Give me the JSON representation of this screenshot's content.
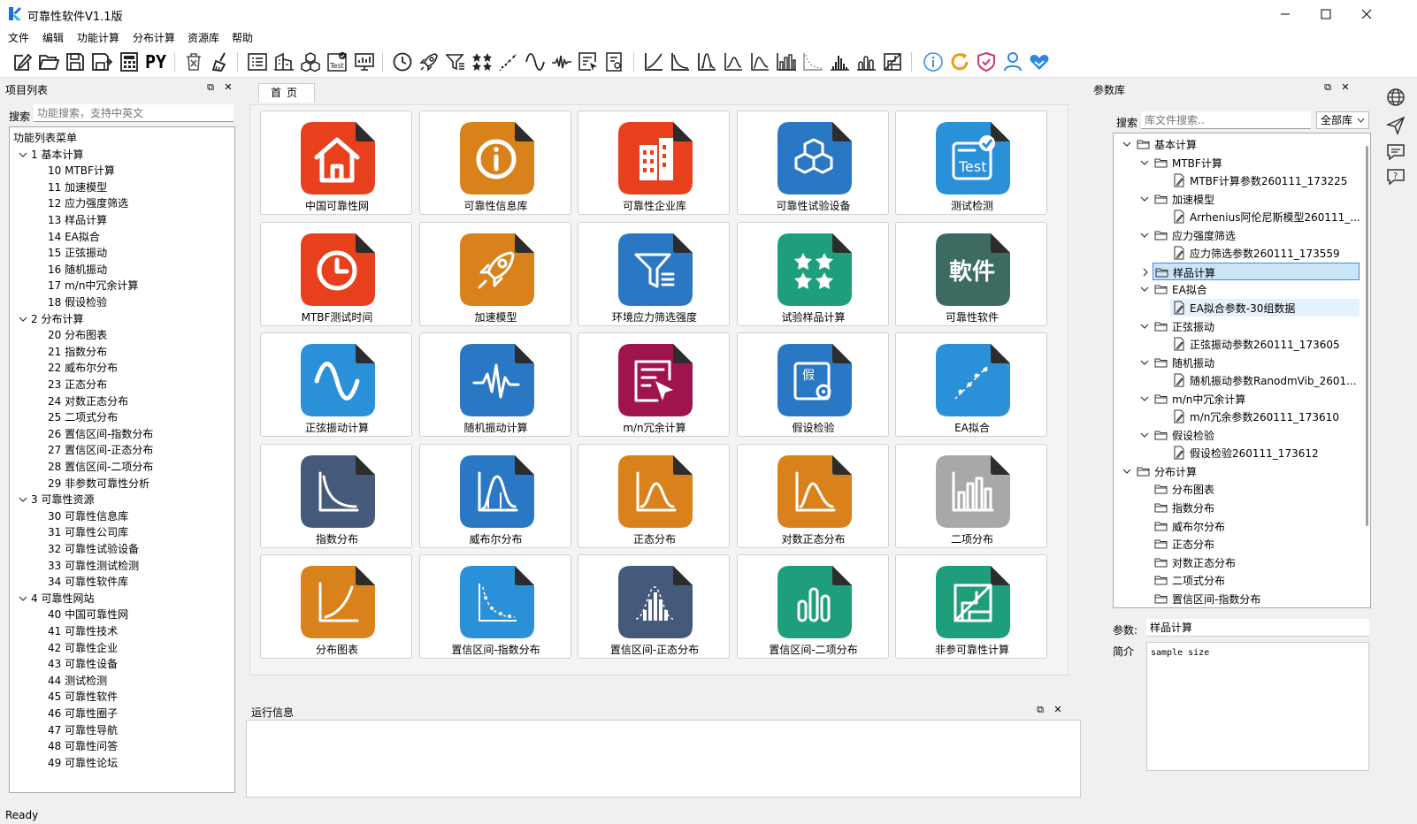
{
  "window": {
    "title": "可靠性软件V1.1版",
    "minimize_icon": "minimize-icon",
    "maximize_icon": "maximize-icon",
    "close_icon": "close-icon"
  },
  "menu": [
    "文件",
    "编辑",
    "功能计算",
    "分布计算",
    "资源库",
    "帮助"
  ],
  "toolbar": {
    "py_label": "PY",
    "test_label": "Test"
  },
  "left_panel": {
    "title": "项目列表",
    "search_label": "搜索",
    "search_placeholder": "功能搜索，支持中英文",
    "root": "功能列表菜单",
    "groups": [
      {
        "label": "1 基本计算",
        "items": [
          "10 MTBF计算",
          "11 加速模型",
          "12 应力强度筛选",
          "13 样品计算",
          "14 EA拟合",
          "15 正弦振动",
          "16 随机振动",
          "17 m/n中冗余计算",
          "18 假设检验"
        ]
      },
      {
        "label": "2 分布计算",
        "items": [
          "20 分布图表",
          "21 指数分布",
          "22 威布尔分布",
          "23 正态分布",
          "24 对数正态分布",
          "25 二项式分布",
          "26 置信区间-指数分布",
          "27 置信区间-正态分布",
          "28 置信区间-二项分布",
          "29 非参数可靠性分析"
        ]
      },
      {
        "label": "3 可靠性资源",
        "items": [
          "30 可靠性信息库",
          "31 可靠性公司库",
          "32 可靠性试验设备",
          "33 可靠性测试检测",
          "34 可靠性软件库"
        ]
      },
      {
        "label": "4 可靠性网站",
        "items": [
          "40 中国可靠性网",
          "41 可靠性技术",
          "42 可靠性企业",
          "43 可靠性设备",
          "44 测试检测",
          "45 可靠性软件",
          "46 可靠性圈子",
          "47 可靠性导航",
          "48 可靠性问答",
          "49 可靠性论坛"
        ]
      }
    ]
  },
  "center": {
    "tab": "首页",
    "cards": [
      {
        "label": "中国可靠性网",
        "icon": "home-icon",
        "color": "#e8401c"
      },
      {
        "label": "可靠性信息库",
        "icon": "info-icon",
        "color": "#d9821c"
      },
      {
        "label": "可靠性企业库",
        "icon": "building-icon",
        "color": "#e8401c"
      },
      {
        "label": "可靠性试验设备",
        "icon": "cubes-icon",
        "color": "#2a78c4"
      },
      {
        "label": "测试检测",
        "icon": "test-check-icon",
        "color": "#2a90d8"
      },
      {
        "label": "MTBF测试时间",
        "icon": "clock-icon",
        "color": "#e8401c"
      },
      {
        "label": "加速模型",
        "icon": "rocket-icon",
        "color": "#d9821c"
      },
      {
        "label": "环境应力筛选强度",
        "icon": "filter-icon",
        "color": "#2a78c4"
      },
      {
        "label": "试验样品计算",
        "icon": "stars-icon",
        "color": "#1e9e7a"
      },
      {
        "label": "可靠性软件",
        "icon": "software-text-icon",
        "color": "#3d6b62",
        "text": "軟件"
      },
      {
        "label": "正弦振动计算",
        "icon": "sine-wave-icon",
        "color": "#2a90d8"
      },
      {
        "label": "随机振动计算",
        "icon": "random-wave-icon",
        "color": "#2a78c4"
      },
      {
        "label": "m/n冗余计算",
        "icon": "form-pointer-icon",
        "color": "#a0144e"
      },
      {
        "label": "假设检验",
        "icon": "hypothesis-icon",
        "color": "#2a78c4",
        "text": "假"
      },
      {
        "label": "EA拟合",
        "icon": "scatter-fit-icon",
        "color": "#2a90d8"
      },
      {
        "label": "指数分布",
        "icon": "exp-curve-icon",
        "color": "#455a7a"
      },
      {
        "label": "威布尔分布",
        "icon": "weibull-curve-icon",
        "color": "#2a78c4"
      },
      {
        "label": "正态分布",
        "icon": "normal-curve-icon",
        "color": "#d9821c"
      },
      {
        "label": "对数正态分布",
        "icon": "lognormal-curve-icon",
        "color": "#d9821c"
      },
      {
        "label": "二项分布",
        "icon": "bar-chart-icon",
        "color": "#a8a8a8"
      },
      {
        "label": "分布图表",
        "icon": "curve-chart-icon",
        "color": "#d9821c"
      },
      {
        "label": "置信区间-指数分布",
        "icon": "confidence-exp-icon",
        "color": "#2a90d8"
      },
      {
        "label": "置信区间-正态分布",
        "icon": "confidence-normal-icon",
        "color": "#455a7a"
      },
      {
        "label": "置信区间-二项分布",
        "icon": "confidence-binomial-icon",
        "color": "#1e9e7a"
      },
      {
        "label": "非参可靠性计算",
        "icon": "nonparam-icon",
        "color": "#1e9e7a"
      }
    ]
  },
  "run_panel": {
    "title": "运行信息"
  },
  "right_panel": {
    "title": "参数库",
    "search_label": "搜索",
    "search_placeholder": "库文件搜索..",
    "select_value": "全部库",
    "tree": [
      {
        "level": 0,
        "label": "基本计算",
        "type": "folder",
        "expanded": true
      },
      {
        "level": 1,
        "label": "MTBF计算",
        "type": "folder",
        "expanded": true
      },
      {
        "level": 2,
        "label": "MTBF计算参数260111_173225",
        "type": "doc"
      },
      {
        "level": 1,
        "label": "加速模型",
        "type": "folder",
        "expanded": true
      },
      {
        "level": 2,
        "label": "Arrhenius阿伦尼斯模型260111_...",
        "type": "doc"
      },
      {
        "level": 1,
        "label": "应力强度筛选",
        "type": "folder",
        "expanded": true
      },
      {
        "level": 2,
        "label": "应力筛选参数260111_173559",
        "type": "doc"
      },
      {
        "level": 1,
        "label": "样品计算",
        "type": "folder",
        "expanded": false,
        "selected": true
      },
      {
        "level": 1,
        "label": "EA拟合",
        "type": "folder",
        "expanded": true
      },
      {
        "level": 2,
        "label": "EA拟合参数-30组数据",
        "type": "doc",
        "hover": true
      },
      {
        "level": 1,
        "label": "正弦振动",
        "type": "folder",
        "expanded": true
      },
      {
        "level": 2,
        "label": "正弦振动参数260111_173605",
        "type": "doc"
      },
      {
        "level": 1,
        "label": "随机振动",
        "type": "folder",
        "expanded": true
      },
      {
        "level": 2,
        "label": "随机振动参数RanodmVib_2601...",
        "type": "doc"
      },
      {
        "level": 1,
        "label": "m/n中冗余计算",
        "type": "folder",
        "expanded": true
      },
      {
        "level": 2,
        "label": "m/n冗余参数260111_173610",
        "type": "doc"
      },
      {
        "level": 1,
        "label": "假设检验",
        "type": "folder",
        "expanded": true
      },
      {
        "level": 2,
        "label": "假设检验260111_173612",
        "type": "doc"
      },
      {
        "level": 0,
        "label": "分布计算",
        "type": "folder",
        "expanded": true
      },
      {
        "level": 1,
        "label": "分布图表",
        "type": "folder-leaf"
      },
      {
        "level": 1,
        "label": "指数分布",
        "type": "folder-leaf"
      },
      {
        "level": 1,
        "label": "威布尔分布",
        "type": "folder-leaf"
      },
      {
        "level": 1,
        "label": "正态分布",
        "type": "folder-leaf"
      },
      {
        "level": 1,
        "label": "对数正态分布",
        "type": "folder-leaf"
      },
      {
        "level": 1,
        "label": "二项式分布",
        "type": "folder-leaf"
      },
      {
        "level": 1,
        "label": "置信区间-指数分布",
        "type": "folder-leaf"
      }
    ],
    "param_label": "参数:",
    "param_value": "样品计算",
    "desc_label": "简介",
    "desc_value": "sample size"
  },
  "side_icons": [
    "globe-icon",
    "send-icon",
    "chat-icon",
    "help-chat-icon"
  ],
  "status": "Ready"
}
